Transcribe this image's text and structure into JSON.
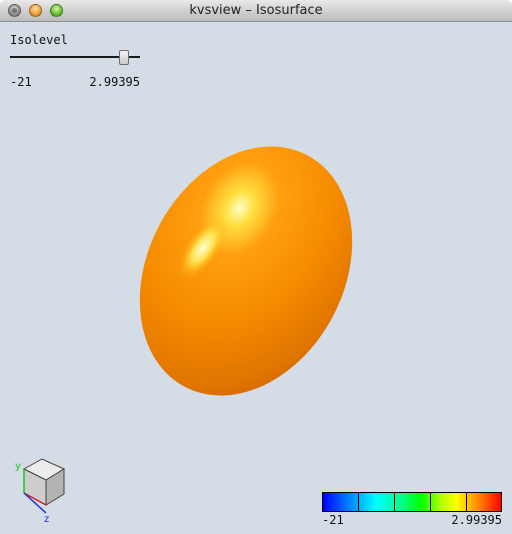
{
  "window": {
    "title": "kvsview – Isosurface"
  },
  "slider": {
    "label": "Isolevel",
    "min_label": "-21",
    "max_label": "2.99395",
    "value_fraction": 0.92
  },
  "colorbar": {
    "min_label": "-21",
    "max_label": "2.99395",
    "colors": [
      "#0000ff",
      "#00ffff",
      "#00ff00",
      "#ffff00",
      "#ff0000"
    ]
  },
  "axes": {
    "x_label": "",
    "y_label": "y",
    "z_label": "z"
  },
  "surface": {
    "color": "#f08000"
  }
}
